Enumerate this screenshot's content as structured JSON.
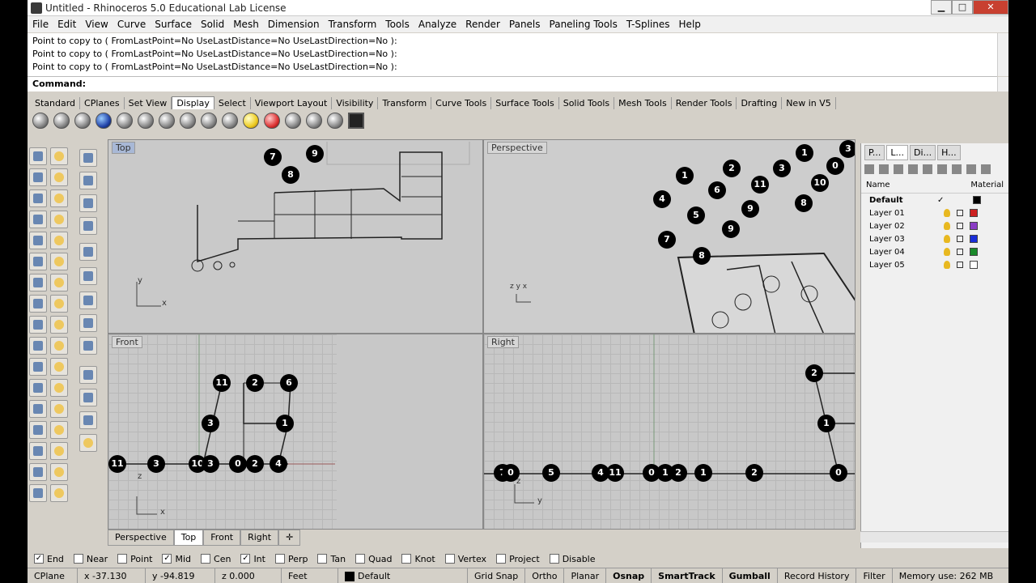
{
  "window": {
    "title": "Untitled - Rhinoceros 5.0 Educational Lab License",
    "minimize": "▁",
    "maximize": "□",
    "close": "✕"
  },
  "menu": [
    "File",
    "Edit",
    "View",
    "Curve",
    "Surface",
    "Solid",
    "Mesh",
    "Dimension",
    "Transform",
    "Tools",
    "Analyze",
    "Render",
    "Panels",
    "Paneling Tools",
    "T-Splines",
    "Help"
  ],
  "command_history": [
    "Point to copy to ( FromLastPoint=No  UseLastDistance=No  UseLastDirection=No ):",
    "Point to copy to ( FromLastPoint=No  UseLastDistance=No  UseLastDirection=No ):",
    "Point to copy to ( FromLastPoint=No  UseLastDistance=No  UseLastDirection=No ):"
  ],
  "command": {
    "label": "Command:",
    "value": ""
  },
  "toolbar_tabs": [
    "Standard",
    "CPlanes",
    "Set View",
    "Display",
    "Select",
    "Viewport Layout",
    "Visibility",
    "Transform",
    "Curve Tools",
    "Surface Tools",
    "Solid Tools",
    "Mesh Tools",
    "Render Tools",
    "Drafting",
    "New in V5"
  ],
  "active_toolbar_tab": "Display",
  "viewports": {
    "top": {
      "label": "Top",
      "active": true,
      "points": [
        "7",
        "9",
        "8"
      ]
    },
    "perspective": {
      "label": "Perspective",
      "points": [
        "1",
        "2",
        "3",
        "3",
        "0",
        "1",
        "6",
        "11",
        "10",
        "4",
        "5",
        "9",
        "8",
        "7",
        "9",
        "8"
      ]
    },
    "front": {
      "label": "Front",
      "points": [
        "11",
        "2",
        "6",
        "3",
        "1",
        "11",
        "3",
        "10",
        "3",
        "0",
        "2",
        "4"
      ]
    },
    "right": {
      "label": "Right",
      "points": [
        "2",
        "1",
        "7",
        "0",
        "5",
        "4",
        "11",
        "0",
        "1",
        "2",
        "1",
        "2",
        "0"
      ]
    }
  },
  "axis_labels": {
    "top_y": "y",
    "top_x": "x",
    "persp": "z y x",
    "front_z": "z",
    "front_x": "x",
    "right_z": "z",
    "right_y": "y"
  },
  "viewport_tabs": [
    "Perspective",
    "Top",
    "Front",
    "Right"
  ],
  "active_viewport_tab": "Top",
  "panel": {
    "tabs": [
      "P...",
      "L...",
      "Di...",
      "H..."
    ],
    "columns": {
      "name": "Name",
      "material": "Material"
    },
    "layers": [
      {
        "name": "Default",
        "current": "✓",
        "color": "#000000"
      },
      {
        "name": "Layer 01",
        "current": "",
        "color": "#cc2020"
      },
      {
        "name": "Layer 02",
        "current": "",
        "color": "#8a3bc4"
      },
      {
        "name": "Layer 03",
        "current": "",
        "color": "#1a2ed8"
      },
      {
        "name": "Layer 04",
        "current": "",
        "color": "#1a8a2a"
      },
      {
        "name": "Layer 05",
        "current": "",
        "color": "#ffffff"
      }
    ]
  },
  "osnaps": [
    {
      "label": "End",
      "checked": true
    },
    {
      "label": "Near",
      "checked": false
    },
    {
      "label": "Point",
      "checked": false
    },
    {
      "label": "Mid",
      "checked": true
    },
    {
      "label": "Cen",
      "checked": false
    },
    {
      "label": "Int",
      "checked": true
    },
    {
      "label": "Perp",
      "checked": false
    },
    {
      "label": "Tan",
      "checked": false
    },
    {
      "label": "Quad",
      "checked": false
    },
    {
      "label": "Knot",
      "checked": false
    },
    {
      "label": "Vertex",
      "checked": false
    },
    {
      "label": "Project",
      "checked": false
    },
    {
      "label": "Disable",
      "checked": false
    }
  ],
  "status": {
    "cplane": "CPlane",
    "x": "x -37.130",
    "y": "y -94.819",
    "z": "z 0.000",
    "units": "Feet",
    "layer": "Default",
    "grid_snap": "Grid Snap",
    "ortho": "Ortho",
    "planar": "Planar",
    "osnap": "Osnap",
    "smarttrack": "SmartTrack",
    "gumball": "Gumball",
    "record_history": "Record History",
    "filter": "Filter",
    "memory": "Memory use: 262 MB"
  }
}
